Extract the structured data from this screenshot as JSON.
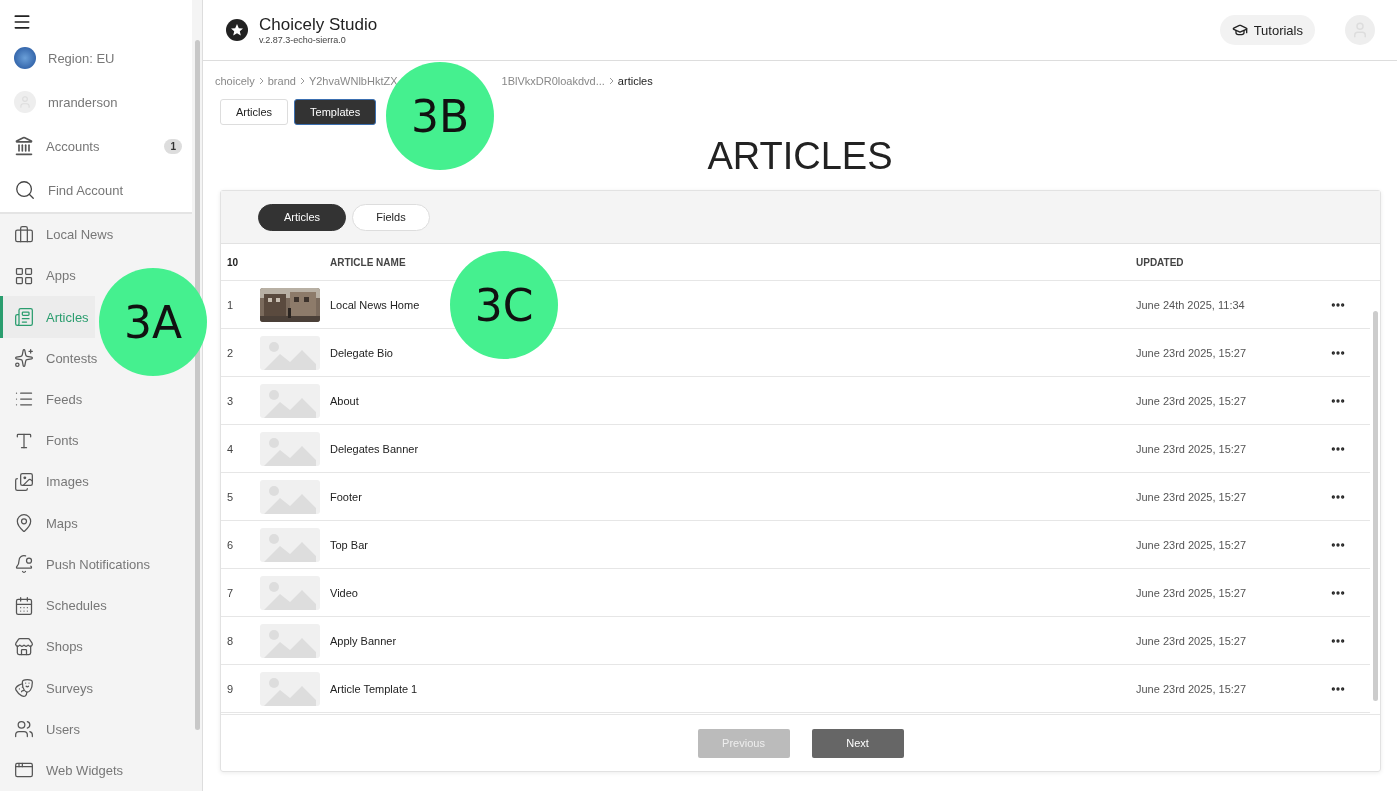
{
  "sidebar": {
    "account_items": [
      {
        "label": "Region: EU"
      },
      {
        "label": "mranderson"
      },
      {
        "label": "Accounts",
        "badge": "1"
      },
      {
        "label": "Find Account"
      }
    ],
    "nav_items": [
      {
        "label": "Local News",
        "selected": false
      },
      {
        "label": "Apps",
        "selected": false
      },
      {
        "label": "Articles",
        "selected": true
      },
      {
        "label": "Contests",
        "selected": false
      },
      {
        "label": "Feeds",
        "selected": false
      },
      {
        "label": "Fonts",
        "selected": false
      },
      {
        "label": "Images",
        "selected": false
      },
      {
        "label": "Maps",
        "selected": false
      },
      {
        "label": "Push Notifications",
        "selected": false
      },
      {
        "label": "Schedules",
        "selected": false
      },
      {
        "label": "Shops",
        "selected": false
      },
      {
        "label": "Surveys",
        "selected": false
      },
      {
        "label": "Users",
        "selected": false
      },
      {
        "label": "Web Widgets",
        "selected": false
      }
    ]
  },
  "header": {
    "app_title": "Choicely Studio",
    "version": "v.2.87.3-echo-sierra.0",
    "tutorials_button": "Tutorials"
  },
  "breadcrumb": [
    "choicely",
    "brand",
    "Y2hvaWNlbHktZX",
    "1BlVkxDR0loakdvd...",
    "articles"
  ],
  "view_tabs": [
    {
      "label": "Articles",
      "selected": false
    },
    {
      "label": "Templates",
      "selected": true
    }
  ],
  "page_title": "ARTICLES",
  "card_tabs": [
    {
      "label": "Articles",
      "selected": true
    },
    {
      "label": "Fields",
      "selected": false
    }
  ],
  "table": {
    "count": "10",
    "columns": [
      "ARTICLE NAME",
      "UPDATED"
    ],
    "rows": [
      {
        "index": "1",
        "name": "Local News Home",
        "updated": "June 24th 2025, 11:34",
        "kind": "picture"
      },
      {
        "index": "2",
        "name": "Delegate Bio",
        "updated": "June 23rd 2025, 15:27",
        "kind": "placeholder"
      },
      {
        "index": "3",
        "name": "About",
        "updated": "June 23rd 2025, 15:27",
        "kind": "placeholder"
      },
      {
        "index": "4",
        "name": "Delegates Banner",
        "updated": "June 23rd 2025, 15:27",
        "kind": "placeholder"
      },
      {
        "index": "5",
        "name": "Footer",
        "updated": "June 23rd 2025, 15:27",
        "kind": "placeholder"
      },
      {
        "index": "6",
        "name": "Top Bar",
        "updated": "June 23rd 2025, 15:27",
        "kind": "placeholder"
      },
      {
        "index": "7",
        "name": "Video",
        "updated": "June 23rd 2025, 15:27",
        "kind": "placeholder"
      },
      {
        "index": "8",
        "name": "Apply Banner",
        "updated": "June 23rd 2025, 15:27",
        "kind": "placeholder"
      },
      {
        "index": "9",
        "name": "Article Template 1",
        "updated": "June 23rd 2025, 15:27",
        "kind": "placeholder"
      }
    ]
  },
  "pagination": [
    {
      "label": "Previous",
      "disabled": true
    },
    {
      "label": "Next",
      "disabled": false
    }
  ],
  "callouts": [
    "3A",
    "3B",
    "3C"
  ]
}
